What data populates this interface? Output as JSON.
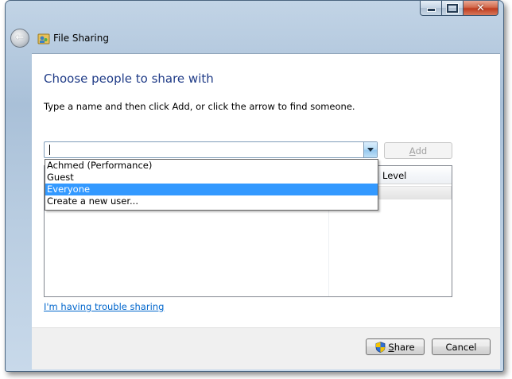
{
  "window": {
    "title": "File Sharing",
    "icons": {
      "back": "back-arrow-icon",
      "app": "file-sharing-icon",
      "minimize": "minimize-icon",
      "maximize": "maximize-icon",
      "close": "close-icon"
    },
    "minimize_glyph": "",
    "maximize_glyph": "",
    "close_glyph": "✕",
    "back_glyph": "←"
  },
  "main": {
    "heading": "Choose people to share with",
    "instruction": "Type a name and then click Add, or click the arrow to find someone.",
    "name_input": {
      "value": "",
      "placeholder": ""
    },
    "add_button": {
      "label_first": "A",
      "label_rest": "dd",
      "enabled": false
    },
    "dropdown": {
      "open": true,
      "options": [
        "Achmed (Performance)",
        "Guest",
        "Everyone",
        "Create a new user..."
      ],
      "selected": "Everyone"
    },
    "list": {
      "visible_column_header": "Level"
    },
    "trouble_link": "I'm having trouble sharing"
  },
  "footer": {
    "share_button": {
      "label_first": "S",
      "label_rest": "hare",
      "icon": "uac-shield-icon"
    },
    "cancel_button": {
      "label": "Cancel"
    }
  },
  "colors": {
    "heading": "#1f3b87",
    "link": "#0066cc",
    "selection": "#3399ff",
    "close_button": "#c8462b"
  }
}
